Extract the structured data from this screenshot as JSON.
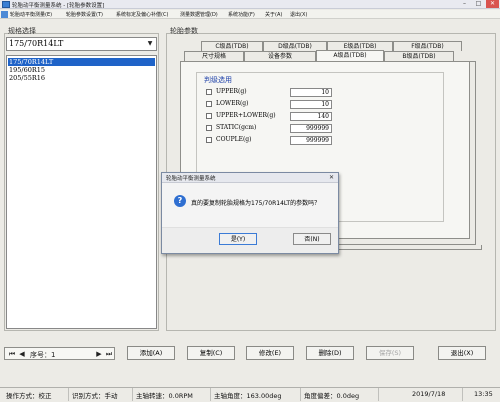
{
  "window": {
    "title": "轮胎动平衡测量系统 - [轮胎参数设置]",
    "minimize": "–",
    "maximize": "□",
    "close": "✕"
  },
  "menu": [
    "轮胎动平衡测量(E)",
    "轮胎参数设置(T)",
    "系统标定及偏心补偿(C)",
    "测量数据管理(D)",
    "系统功能(F)",
    "关于(A)",
    "退出(X)"
  ],
  "left_panel": {
    "title": "规格选择",
    "combo_value": "175/70R14LT",
    "list": [
      "175/70R14LT",
      "195/60R15",
      "205/55R16"
    ]
  },
  "right_panel": {
    "title": "轮胎参数",
    "tabs_back": [
      "C级品(TDB)",
      "D级品(TDB)",
      "E级品(TDB)",
      "F级品(TDB)"
    ],
    "tabs_front": [
      "尺寸规格",
      "设备参数",
      "A级品(TDB)",
      "B级品(TDB)"
    ],
    "section_title": "判级选用",
    "params": [
      {
        "label": "UPPER(g)",
        "value": "10"
      },
      {
        "label": "LOWER(g)",
        "value": "10"
      },
      {
        "label": "UPPER+LOWER(g)",
        "value": "140"
      },
      {
        "label": "STATIC(gcm)",
        "value": "999999"
      },
      {
        "label": "COUPLE(g)",
        "value": "999999"
      }
    ]
  },
  "dialog": {
    "title": "轮胎动平衡测量系统",
    "close": "✕",
    "icon": "?",
    "message": "真的要复制轮胎规格为175/70R14LT的参数吗？",
    "yes": "是(Y)",
    "no": "否(N)"
  },
  "nav": {
    "first": "⏮",
    "prev": "◀",
    "label": "序号：1",
    "next": "▶",
    "last": "⏭"
  },
  "buttons": {
    "add": "添加(A)",
    "copy": "复制(C)",
    "edit": "修改(E)",
    "delete": "删除(D)",
    "save": "保存(S)",
    "exit": "退出(X)"
  },
  "status": {
    "mode": "操作方式：校正",
    "recognize": "识别方式：手动",
    "speed": "主轴转速：0.0RPM",
    "angle": "主轴角度：163.00deg",
    "offset": "角度偏差：0.0deg",
    "date": "2019/7/18",
    "time": "13:35"
  },
  "colors": {
    "selection": "#1f63c8",
    "section_title": "#1c3fa8",
    "question_icon": "#2f6fd1"
  }
}
